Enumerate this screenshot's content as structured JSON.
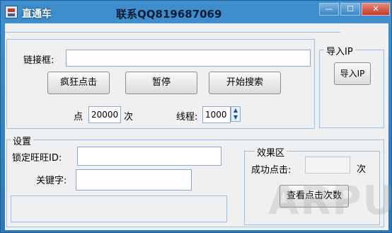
{
  "window": {
    "title": "直通车",
    "contact": "联系QQ819687069"
  },
  "controls": {
    "minimize": "—",
    "maximize": "☐",
    "close": "✕"
  },
  "main": {
    "link_label": "链接框:",
    "link_value": "",
    "crazy_click": "疯狂点击",
    "pause": "暂停",
    "start_search": "开始搜索",
    "click_label": "点",
    "click_count": "20000",
    "times_label": "次",
    "thread_label": "线程:",
    "thread_count": "1000"
  },
  "import_ip": {
    "legend": "导入IP",
    "button": "导入IP"
  },
  "settings": {
    "legend": "设置",
    "wangwang_label": "锁定旺旺ID:",
    "wangwang_value": "",
    "keyword_label": "关键字:",
    "keyword_value": ""
  },
  "effect": {
    "legend": "效果区",
    "success_label": "成功点击:",
    "success_value": "",
    "times_label": "次",
    "view_button": "查看点击次数"
  },
  "watermark": "ARPUN"
}
